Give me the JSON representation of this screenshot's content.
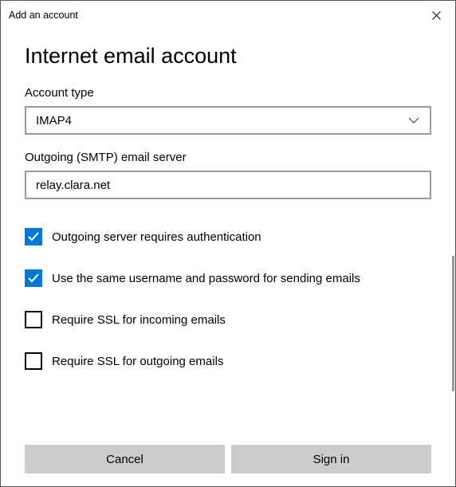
{
  "window": {
    "title": "Add an account"
  },
  "page": {
    "heading": "Internet email account"
  },
  "accountType": {
    "label": "Account type",
    "value": "IMAP4"
  },
  "smtp": {
    "label": "Outgoing (SMTP) email server",
    "value": "relay.clara.net"
  },
  "checkboxes": {
    "outgoingAuth": {
      "label": "Outgoing server requires authentication",
      "checked": true
    },
    "sameCreds": {
      "label": "Use the same username and password for sending emails",
      "checked": true
    },
    "sslIncoming": {
      "label": "Require SSL for incoming emails",
      "checked": false
    },
    "sslOutgoing": {
      "label": "Require SSL for outgoing emails",
      "checked": false
    }
  },
  "buttons": {
    "cancel": "Cancel",
    "signin": "Sign in"
  }
}
